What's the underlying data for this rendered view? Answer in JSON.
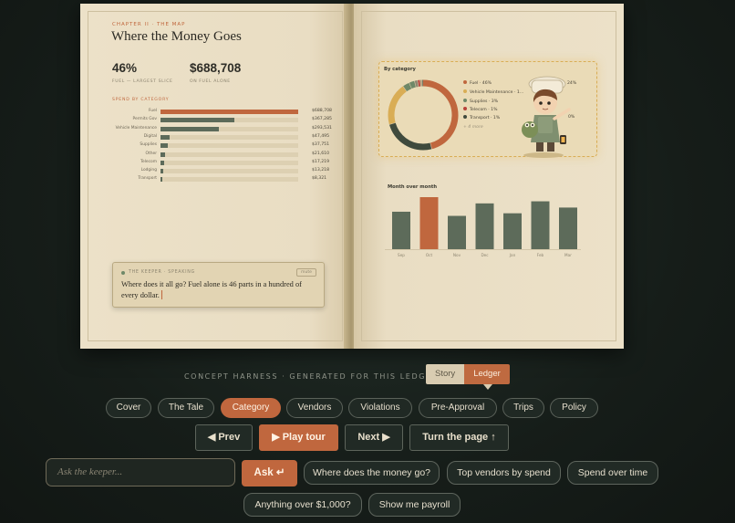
{
  "left_page": {
    "chapter": "CHAPTER II · THE MAP",
    "title": "Where the Money Goes",
    "stat1_value": "46%",
    "stat1_label": "FUEL — LARGEST SLICE",
    "stat2_value": "$688,708",
    "stat2_label": "ON FUEL ALONE",
    "spend_heading": "SPEND BY CATEGORY",
    "spend_rows": [
      {
        "label": "Fuel",
        "value": "$688,708",
        "amount": 688708,
        "color": "#c0673e"
      },
      {
        "label": "Permits Gov",
        "value": "$367,285",
        "amount": 367285,
        "color": "#5d6b5a"
      },
      {
        "label": "Vehicle Maintenance",
        "value": "$293,531",
        "amount": 293531,
        "color": "#5d6b5a"
      },
      {
        "label": "Digital",
        "value": "$47,495",
        "amount": 47495,
        "color": "#5d6b5a"
      },
      {
        "label": "Supplies",
        "value": "$37,751",
        "amount": 37751,
        "color": "#5d6b5a"
      },
      {
        "label": "Other",
        "value": "$21,610",
        "amount": 21610,
        "color": "#5d6b5a"
      },
      {
        "label": "Telecom",
        "value": "$17,219",
        "amount": 17219,
        "color": "#5d6b5a"
      },
      {
        "label": "Lodging",
        "value": "$13,218",
        "amount": 13218,
        "color": "#5d6b5a"
      },
      {
        "label": "Transport",
        "value": "$8,321",
        "amount": 8321,
        "color": "#5d6b5a"
      }
    ],
    "keeper": {
      "heading": "THE KEEPER · SPEAKING",
      "mute_label": "mute",
      "text": "Where does it all go? Fuel alone is 46 parts in a hundred of every dollar."
    }
  },
  "right_page": {
    "category_title": "By category",
    "legend": [
      {
        "label": "Fuel · 46%",
        "color": "#c0673e"
      },
      {
        "label": "Vehicle Maintenance · 1…",
        "color": "#d9ad55"
      },
      {
        "label": "Supplies · 3%",
        "color": "#6f8868"
      },
      {
        "label": "Telecom · 1%",
        "color": "#b8413a"
      },
      {
        "label": "Transport · 1%",
        "color": "#3f4a3d"
      }
    ],
    "legend_more": "+ 4 more",
    "pct_top": "24%",
    "pct_mid": "0%",
    "mom_title": "Month over month"
  },
  "chart_data": [
    {
      "type": "pie",
      "title": "By category",
      "categories": [
        "Fuel",
        "Permits Gov",
        "Vehicle Maintenance",
        "Digital",
        "Supplies",
        "Other",
        "Telecom",
        "Lodging",
        "Transport"
      ],
      "values": [
        688708,
        367285,
        293531,
        47495,
        37751,
        21610,
        17219,
        13218,
        8321
      ],
      "colors": [
        "#c0673e",
        "#3f4a3d",
        "#d9ad55",
        "#6f8868",
        "#6f8868",
        "#8e8670",
        "#b8413a",
        "#a89978",
        "#3f4a3d"
      ]
    },
    {
      "type": "bar",
      "title": "Month over month",
      "categories": [
        "Sep",
        "Oct",
        "Nov",
        "Dec",
        "Jan",
        "Feb",
        "Mar"
      ],
      "values": [
        0.72,
        1.0,
        0.64,
        0.88,
        0.69,
        0.92,
        0.8
      ],
      "highlight_index": 1,
      "colors": {
        "normal": "#5d6b5a",
        "highlight": "#c0673e"
      }
    }
  ],
  "harness_text": "CONCEPT HARNESS · GENERATED FOR THIS LEDGER",
  "toggle": {
    "story": "Story",
    "ledger": "Ledger"
  },
  "nav_tabs": [
    "Cover",
    "The Tale",
    "Category",
    "Vendors",
    "Violations",
    "Pre-Approval",
    "Trips",
    "Policy"
  ],
  "nav_active": "Category",
  "controls": {
    "prev": "◀ Prev",
    "play": "▶ Play tour",
    "next": "Next ▶",
    "turn": "Turn the page ↑"
  },
  "ask": {
    "placeholder": "Ask the keeper...",
    "button": "Ask ↵"
  },
  "suggestions": [
    "Where does the money go?",
    "Top vendors by spend",
    "Spend over time",
    "Anything over $1,000?",
    "Show me payroll"
  ]
}
